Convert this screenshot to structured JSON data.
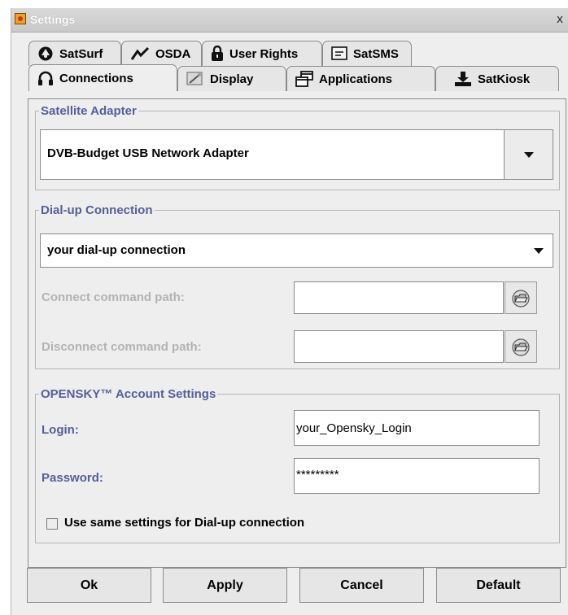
{
  "window": {
    "title": "Settings",
    "close_glyph": "x"
  },
  "tabs_row1": [
    {
      "label": "SatSurf",
      "icon": "satsurf-icon"
    },
    {
      "label": "OSDA",
      "icon": "osda-icon"
    },
    {
      "label": "User Rights",
      "icon": "lock-icon"
    },
    {
      "label": "SatSMS",
      "icon": "sms-icon"
    }
  ],
  "tabs_row2": [
    {
      "label": "Connections",
      "icon": "connections-icon",
      "active": true
    },
    {
      "label": "Display",
      "icon": "display-icon"
    },
    {
      "label": "Applications",
      "icon": "applications-icon"
    },
    {
      "label": "SatKiosk",
      "icon": "kiosk-icon"
    }
  ],
  "satellite": {
    "legend": "Satellite Adapter",
    "selected": "DVB-Budget USB Network Adapter"
  },
  "dialup": {
    "legend": "Dial-up Connection",
    "selected": "your dial-up connection",
    "connect_label": "Connect command path:",
    "connect_value": "",
    "disconnect_label": "Disconnect command path:",
    "disconnect_value": ""
  },
  "account": {
    "legend": "OPENSKY™ Account Settings",
    "login_label": "Login:",
    "login_value": "your_Opensky_Login",
    "password_label": "Password:",
    "password_value": "*********",
    "same_settings_label": "Use same settings for Dial-up connection",
    "same_settings_checked": false
  },
  "buttons": {
    "ok": "Ok",
    "apply": "Apply",
    "cancel": "Cancel",
    "default": "Default"
  },
  "colors": {
    "group_label": "#545f99",
    "disabled_label": "#b3b3b3",
    "window_bg": "#eeeeee"
  }
}
